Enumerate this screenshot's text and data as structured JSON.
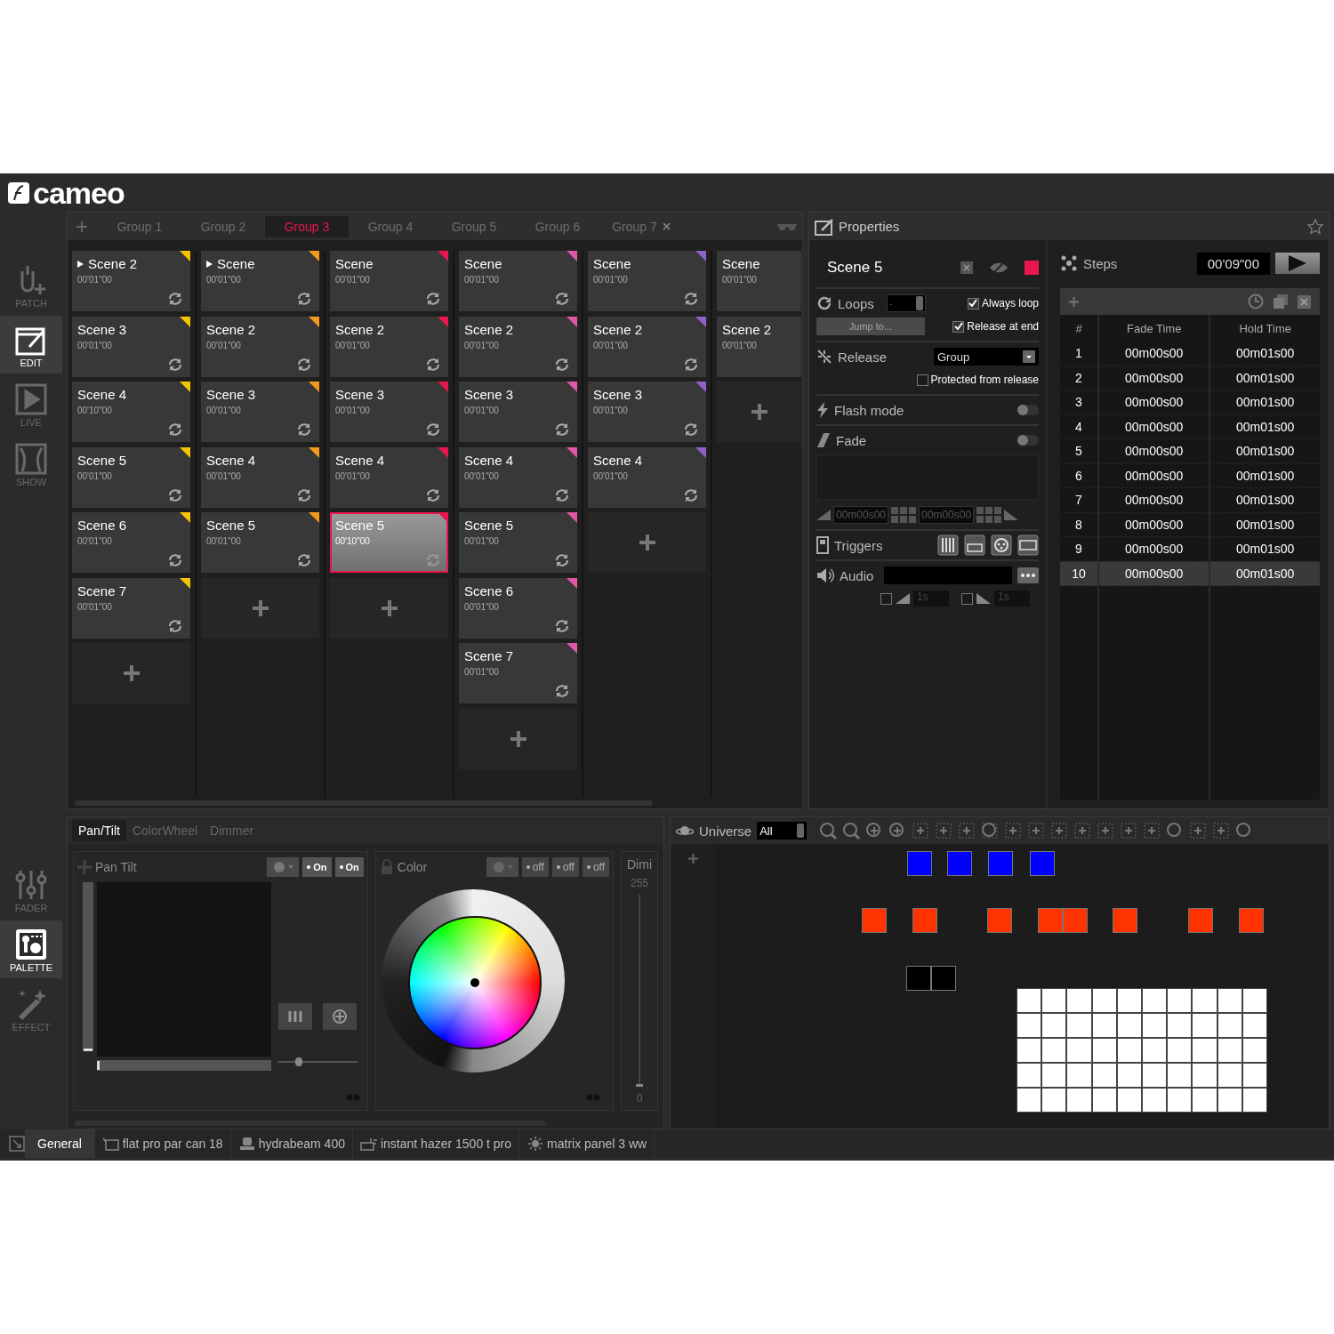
{
  "logo": "cameo",
  "sidebar_top": [
    {
      "label": "PATCH",
      "kind": "patch",
      "selected": false
    },
    {
      "label": "EDIT",
      "kind": "edit",
      "selected": true
    },
    {
      "label": "LIVE",
      "kind": "live",
      "selected": false
    },
    {
      "label": "SHOW",
      "kind": "show",
      "selected": false
    }
  ],
  "sidebar_bottom": [
    {
      "label": "FADER",
      "kind": "fader",
      "selected": false
    },
    {
      "label": "PALETTE",
      "kind": "palette",
      "selected": true
    },
    {
      "label": "EFFECT",
      "kind": "effect",
      "selected": false
    }
  ],
  "group_tabs": [
    {
      "label": "Group 1",
      "selected": false,
      "closable": false
    },
    {
      "label": "Group 2",
      "selected": false,
      "closable": false
    },
    {
      "label": "Group 3",
      "selected": true,
      "closable": false
    },
    {
      "label": "Group 4",
      "selected": false,
      "closable": false
    },
    {
      "label": "Group 5",
      "selected": false,
      "closable": false
    },
    {
      "label": "Group 6",
      "selected": false,
      "closable": false
    },
    {
      "label": "Group 7",
      "selected": false,
      "closable": true
    }
  ],
  "columns": [
    {
      "color": "#f5c400",
      "scenes": [
        {
          "name": "Scene 2",
          "time": "00'01\"00",
          "playing": true,
          "repeat": true,
          "selected": false
        },
        {
          "name": "Scene 3",
          "time": "00'01\"00",
          "playing": false,
          "repeat": true,
          "selected": false
        },
        {
          "name": "Scene 4",
          "time": "00'10\"00",
          "playing": false,
          "repeat": true,
          "selected": false
        },
        {
          "name": "Scene 5",
          "time": "00'01\"00",
          "playing": false,
          "repeat": true,
          "selected": false
        },
        {
          "name": "Scene 6",
          "time": "00'01\"00",
          "playing": false,
          "repeat": true,
          "selected": false
        },
        {
          "name": "Scene 7",
          "time": "00'01\"00",
          "playing": false,
          "repeat": true,
          "selected": false
        }
      ]
    },
    {
      "color": "#f39a1e",
      "scenes": [
        {
          "name": "Scene",
          "time": "00'01\"00",
          "playing": true,
          "repeat": true,
          "selected": false
        },
        {
          "name": "Scene 2",
          "time": "00'01\"00",
          "playing": false,
          "repeat": true,
          "selected": false
        },
        {
          "name": "Scene 3",
          "time": "00'01\"00",
          "playing": false,
          "repeat": true,
          "selected": false
        },
        {
          "name": "Scene 4",
          "time": "00'01\"00",
          "playing": false,
          "repeat": true,
          "selected": false
        },
        {
          "name": "Scene 5",
          "time": "00'01\"00",
          "playing": false,
          "repeat": true,
          "selected": false
        }
      ]
    },
    {
      "color": "#e8174f",
      "scenes": [
        {
          "name": "Scene",
          "time": "00'01\"00",
          "playing": false,
          "repeat": true,
          "selected": false
        },
        {
          "name": "Scene 2",
          "time": "00'01\"00",
          "playing": false,
          "repeat": true,
          "selected": false
        },
        {
          "name": "Scene 3",
          "time": "00'01\"00",
          "playing": false,
          "repeat": true,
          "selected": false
        },
        {
          "name": "Scene 4",
          "time": "00'01\"00",
          "playing": false,
          "repeat": true,
          "selected": false
        },
        {
          "name": "Scene 5",
          "time": "00'10\"00",
          "playing": false,
          "repeat": true,
          "selected": true
        }
      ]
    },
    {
      "color": "#e056a8",
      "scenes": [
        {
          "name": "Scene",
          "time": "00'01\"00",
          "playing": false,
          "repeat": true,
          "selected": false
        },
        {
          "name": "Scene 2",
          "time": "00'01\"00",
          "playing": false,
          "repeat": true,
          "selected": false
        },
        {
          "name": "Scene 3",
          "time": "00'01\"00",
          "playing": false,
          "repeat": true,
          "selected": false
        },
        {
          "name": "Scene 4",
          "time": "00'01\"00",
          "playing": false,
          "repeat": true,
          "selected": false
        },
        {
          "name": "Scene 5",
          "time": "00'01\"00",
          "playing": false,
          "repeat": true,
          "selected": false
        },
        {
          "name": "Scene 6",
          "time": "00'01\"00",
          "playing": false,
          "repeat": true,
          "selected": false
        },
        {
          "name": "Scene 7",
          "time": "00'01\"00",
          "playing": false,
          "repeat": true,
          "selected": false
        }
      ]
    },
    {
      "color": "#9061c9",
      "scenes": [
        {
          "name": "Scene",
          "time": "00'01\"00",
          "playing": false,
          "repeat": true,
          "selected": false
        },
        {
          "name": "Scene 2",
          "time": "00'01\"00",
          "playing": false,
          "repeat": true,
          "selected": false
        },
        {
          "name": "Scene 3",
          "time": "00'01\"00",
          "playing": false,
          "repeat": true,
          "selected": false
        },
        {
          "name": "Scene 4",
          "time": "00'01\"00",
          "playing": false,
          "repeat": true,
          "selected": false
        }
      ]
    },
    {
      "scenes": [
        {
          "name": "Scene",
          "time": "00'01\"00",
          "selected": false
        },
        {
          "name": "Scene 2",
          "time": "00'01\"00",
          "selected": false
        }
      ]
    }
  ],
  "properties": {
    "title": "Properties",
    "scene_name": "Scene 5",
    "loops": {
      "label": "Loops",
      "value": "-",
      "jump_button": "Jump to..."
    },
    "always_loop": {
      "label": "Always loop",
      "checked": true
    },
    "release_at_end": {
      "label": "Release at end",
      "checked": true
    },
    "release": {
      "label": "Release",
      "value": "Group"
    },
    "protected": {
      "label": "Protected from release",
      "checked": false
    },
    "flash_mode": {
      "label": "Flash mode",
      "on": false
    },
    "fade": {
      "label": "Fade",
      "on": false,
      "fade_in": "00m00s00",
      "fade_out": "00m00s00"
    },
    "triggers": {
      "label": "Triggers"
    },
    "audio": {
      "label": "Audio",
      "fade_in": {
        "checked": false,
        "value": "1s"
      },
      "fade_out": {
        "checked": false,
        "value": "1s"
      }
    }
  },
  "steps": {
    "title": "Steps",
    "duration": "00'09\"00",
    "columns": [
      "#",
      "Fade Time",
      "Hold Time"
    ],
    "rows": [
      {
        "n": "1",
        "fade": "00m00s00",
        "hold": "00m01s00",
        "selected": false
      },
      {
        "n": "2",
        "fade": "00m00s00",
        "hold": "00m01s00",
        "selected": false
      },
      {
        "n": "3",
        "fade": "00m00s00",
        "hold": "00m01s00",
        "selected": false
      },
      {
        "n": "4",
        "fade": "00m00s00",
        "hold": "00m01s00",
        "selected": false
      },
      {
        "n": "5",
        "fade": "00m00s00",
        "hold": "00m01s00",
        "selected": false
      },
      {
        "n": "6",
        "fade": "00m00s00",
        "hold": "00m01s00",
        "selected": false
      },
      {
        "n": "7",
        "fade": "00m00s00",
        "hold": "00m01s00",
        "selected": false
      },
      {
        "n": "8",
        "fade": "00m00s00",
        "hold": "00m01s00",
        "selected": false
      },
      {
        "n": "9",
        "fade": "00m00s00",
        "hold": "00m01s00",
        "selected": false
      },
      {
        "n": "10",
        "fade": "00m00s00",
        "hold": "00m01s00",
        "selected": true
      }
    ]
  },
  "palette": {
    "tabs": [
      {
        "label": "Pan/Tilt",
        "selected": true
      },
      {
        "label": "ColorWheel",
        "selected": false
      },
      {
        "label": "Dimmer",
        "selected": false
      }
    ],
    "pan_tilt": {
      "title": "Pan Tilt",
      "buttons": [
        "On",
        "On"
      ],
      "tilt": {
        "level": 0
      },
      "pan": {
        "level": 0
      },
      "speed": {
        "level": 0.25
      }
    },
    "color": {
      "title": "Color",
      "buttons": [
        "off",
        "off",
        "off"
      ]
    },
    "dimmer": {
      "title": "Dimi",
      "max": "255",
      "min": "0",
      "slider": {
        "level": 0
      }
    }
  },
  "universe": {
    "label": "Universe",
    "filter": "All",
    "fixtures": [
      {
        "kind": "head",
        "color": "#0000ff"
      },
      {
        "kind": "head",
        "color": "#0000ff"
      },
      {
        "kind": "head",
        "color": "#0000ff"
      },
      {
        "kind": "head",
        "color": "#0000ff"
      },
      {
        "kind": "head",
        "color": "#ff3300"
      },
      {
        "kind": "head",
        "color": "#ff3300"
      },
      {
        "kind": "head",
        "color": "#ff3300"
      },
      {
        "kind": "head",
        "color": "#ff3300"
      },
      {
        "kind": "head",
        "color": "#ff3300"
      },
      {
        "kind": "head",
        "color": "#ff3300"
      },
      {
        "kind": "head",
        "color": "#ff3300"
      },
      {
        "kind": "head",
        "color": "#ff3300"
      },
      {
        "kind": "head",
        "color": "#000000"
      },
      {
        "kind": "head",
        "color": "#000000"
      },
      {
        "kind": "matrix",
        "color": "#ffffff"
      }
    ]
  },
  "status_bar": [
    {
      "label": "General",
      "kind": "general",
      "selected": true
    },
    {
      "label": "flat pro par can 18",
      "kind": "par",
      "selected": false
    },
    {
      "label": "hydrabeam 400",
      "kind": "moving-head",
      "selected": false
    },
    {
      "label": "instant hazer 1500 t pro",
      "kind": "hazer",
      "selected": false
    },
    {
      "label": "matrix panel 3 ww",
      "kind": "matrix",
      "selected": false
    }
  ]
}
